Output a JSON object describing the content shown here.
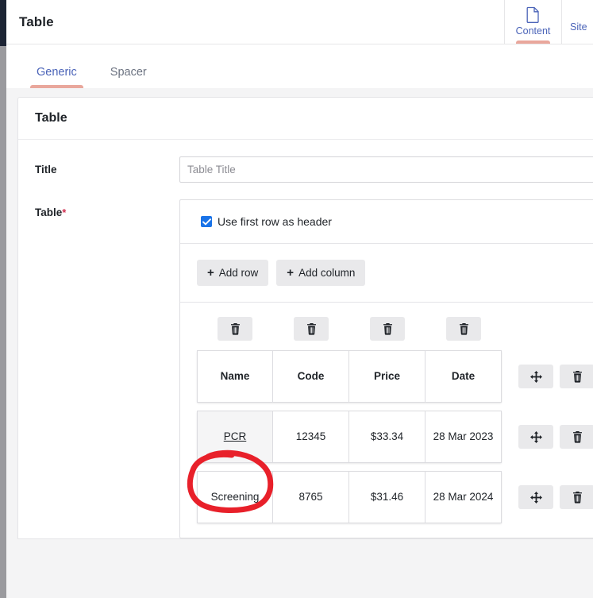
{
  "header": {
    "title": "Table",
    "nav": [
      {
        "label": "Content",
        "icon": "document-icon",
        "active": true
      },
      {
        "label": "Site",
        "icon": "",
        "active": false
      }
    ]
  },
  "subtabs": [
    {
      "label": "Generic",
      "active": true
    },
    {
      "label": "Spacer",
      "active": false
    }
  ],
  "card": {
    "title": "Table",
    "fields": {
      "title": {
        "label": "Title",
        "placeholder": "Table Title",
        "value": ""
      },
      "table": {
        "label": "Table",
        "required_marker": "*",
        "use_first_row_as_header": {
          "label": "Use first row as header",
          "checked": true
        },
        "buttons": {
          "add_row": "Add row",
          "add_column": "Add column",
          "plus": "+"
        },
        "column_delete_buttons": [
          "trash-icon",
          "trash-icon",
          "trash-icon",
          "trash-icon"
        ],
        "row_action_labels": {
          "move": "move-icon",
          "delete": "trash-icon"
        },
        "columns": [
          "Name",
          "Code",
          "Price",
          "Date"
        ],
        "rows": [
          {
            "is_header": true,
            "cells": [
              "Name",
              "Code",
              "Price",
              "Date"
            ]
          },
          {
            "is_header": false,
            "active_cell_index": 0,
            "cells": [
              "PCR",
              "12345",
              "$33.34",
              "28 Mar 2023"
            ]
          },
          {
            "is_header": false,
            "cells": [
              "Screening",
              "8765",
              "$31.46",
              "28 Mar 2024"
            ]
          }
        ]
      }
    }
  },
  "annotation": {
    "type": "hand-drawn-circle",
    "color": "#e8202a",
    "target": "PCR"
  },
  "colors": {
    "accent_blue": "#4a63b8",
    "tab_underline": "#e9a79c",
    "checkbox_blue": "#1a73e8",
    "required_red": "#d03050",
    "canvas": "#f4f4f5",
    "annotation_red": "#e8202a"
  }
}
